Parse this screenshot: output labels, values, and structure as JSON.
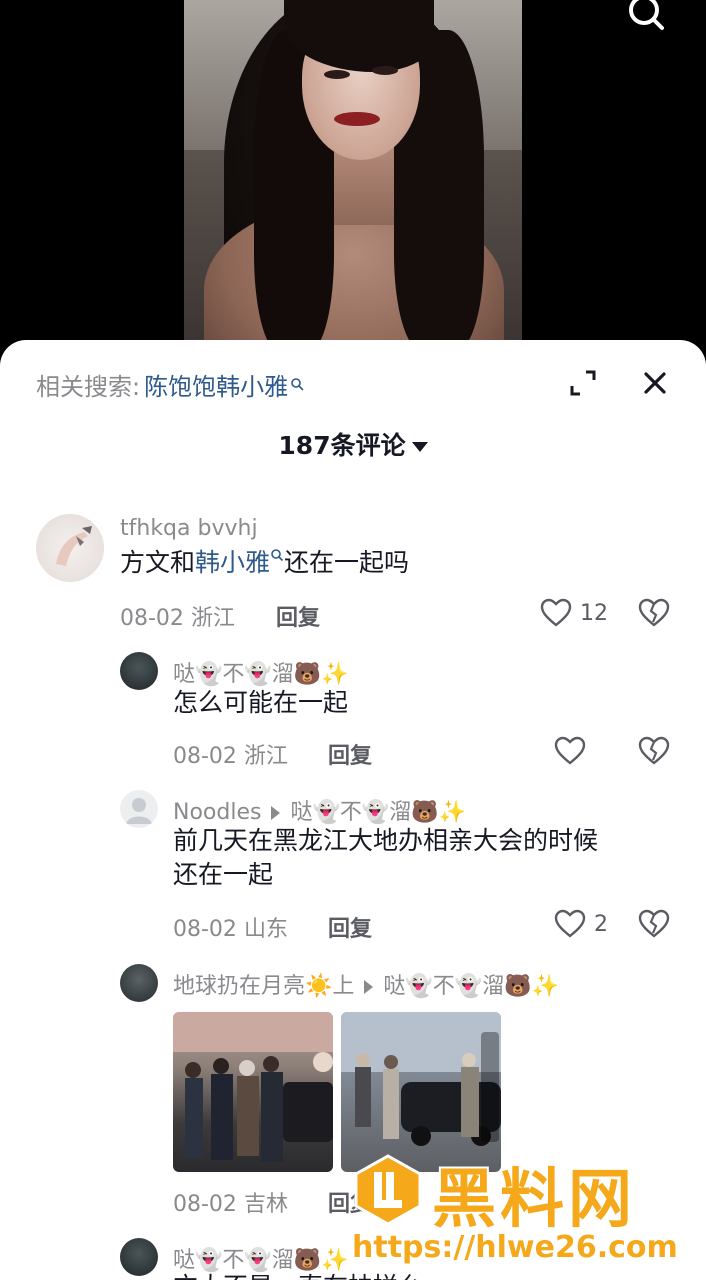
{
  "video": {},
  "related": {
    "label": "相关搜索:",
    "term": "陈饱饱韩小雅"
  },
  "comments_header": {
    "count_label": "187条评论"
  },
  "comments": [
    {
      "user": "tfhkqa bvvhj",
      "text_before": "方文和",
      "text_link": "韩小雅",
      "text_after": "还在一起吗",
      "date": "08-02",
      "region": "浙江",
      "reply_label": "回复",
      "likes": "12"
    }
  ],
  "replies": [
    {
      "user": "哒👻不👻溜🐻✨",
      "text": "怎么可能在一起",
      "date": "08-02",
      "region": "浙江",
      "reply_label": "回复",
      "likes": ""
    },
    {
      "user": "Noodles",
      "reply_to": "哒👻不👻溜🐻✨",
      "text_line1": "前几天在黑龙江大地办相亲大会的时候",
      "text_line2": "还在一起",
      "date": "08-02",
      "region": "山东",
      "reply_label": "回复",
      "likes": "2"
    },
    {
      "user": "地球扔在月亮☀️上",
      "reply_to": "哒👻不👻溜🐻✨",
      "date": "08-02",
      "region": "吉林",
      "reply_label": "回复"
    },
    {
      "user": "哒👻不👻溜🐻✨",
      "text": "方大不是一直在扶拼么"
    }
  ],
  "watermark": {
    "brand": "黑料网",
    "url": "https://hlwe26.com"
  },
  "colors": {
    "link": "#2f5a8c",
    "muted": "#8a8a8e",
    "text": "#161823",
    "watermark": "#f4a81a"
  }
}
